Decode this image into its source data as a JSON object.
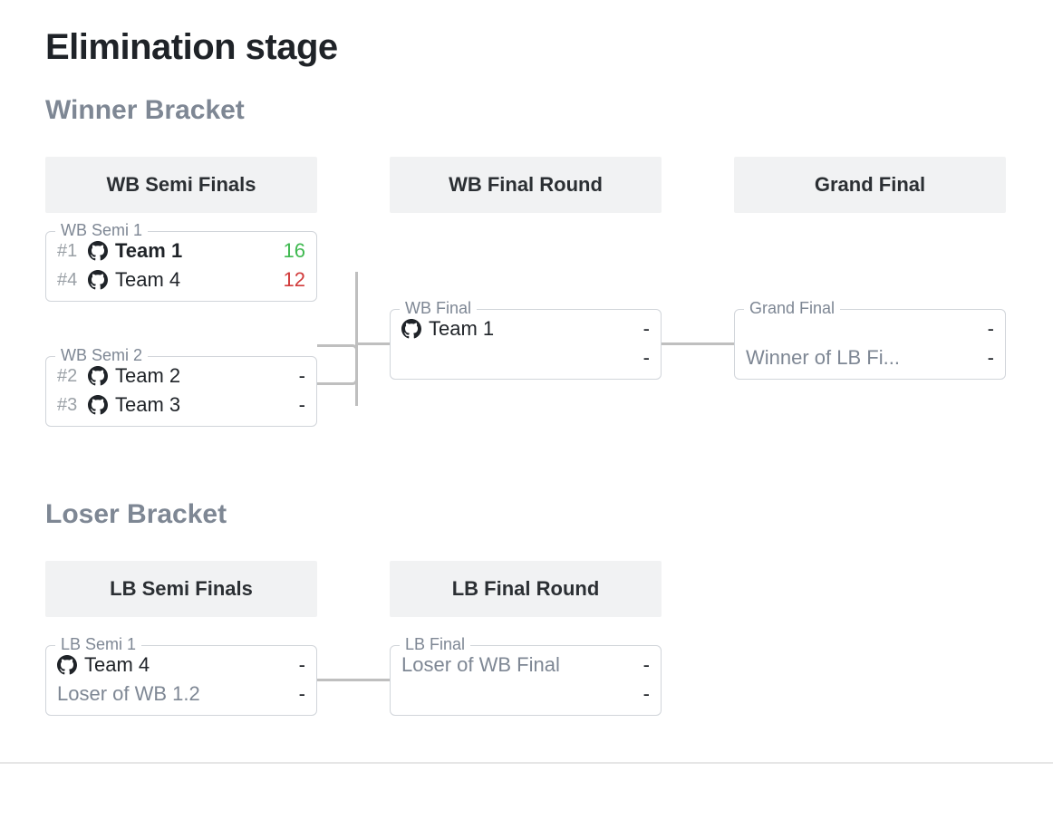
{
  "stage_title": "Elimination stage",
  "winner_bracket": {
    "title": "Winner Bracket",
    "rounds": [
      {
        "header": "WB Semi Finals"
      },
      {
        "header": "WB Final Round"
      },
      {
        "header": "Grand Final"
      }
    ],
    "matches": {
      "wb_semi_1": {
        "label": "WB Semi 1",
        "top": {
          "seed": "#1",
          "name": "Team 1",
          "score": "16",
          "bold": true,
          "result": "win"
        },
        "bottom": {
          "seed": "#4",
          "name": "Team 4",
          "score": "12",
          "bold": false,
          "result": "lose"
        }
      },
      "wb_semi_2": {
        "label": "WB Semi 2",
        "top": {
          "seed": "#2",
          "name": "Team 2",
          "score": "-",
          "result": "none"
        },
        "bottom": {
          "seed": "#3",
          "name": "Team 3",
          "score": "-",
          "result": "none"
        }
      },
      "wb_final": {
        "label": "WB Final",
        "top": {
          "name": "Team 1",
          "score": "-",
          "result": "none"
        },
        "bottom": {
          "name": "",
          "score": "-",
          "result": "none",
          "placeholder": true
        }
      },
      "grand_final": {
        "label": "Grand Final",
        "top": {
          "name": "",
          "score": "-",
          "result": "none",
          "placeholder": true
        },
        "bottom": {
          "name": "Winner of LB Fi...",
          "score": "-",
          "result": "none",
          "placeholder": true
        }
      }
    }
  },
  "loser_bracket": {
    "title": "Loser Bracket",
    "rounds": [
      {
        "header": "LB Semi Finals"
      },
      {
        "header": "LB Final Round"
      }
    ],
    "matches": {
      "lb_semi_1": {
        "label": "LB Semi 1",
        "top": {
          "name": "Team 4",
          "score": "-",
          "result": "none"
        },
        "bottom": {
          "name": "Loser of WB 1.2",
          "score": "-",
          "result": "none",
          "placeholder": true
        }
      },
      "lb_final": {
        "label": "LB Final",
        "top": {
          "name": "Loser of WB Final",
          "score": "-",
          "result": "none",
          "placeholder": true
        },
        "bottom": {
          "name": "",
          "score": "-",
          "result": "none",
          "placeholder": true
        }
      }
    }
  }
}
